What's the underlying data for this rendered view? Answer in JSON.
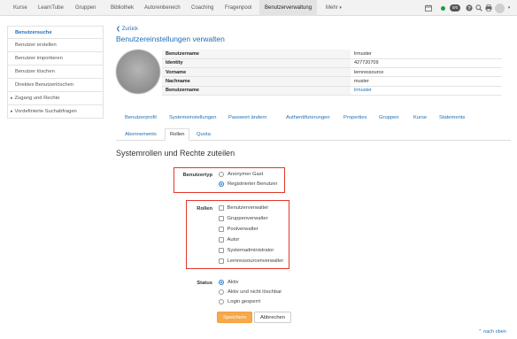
{
  "nav": {
    "items": [
      "Kurse",
      "LearnTube",
      "Gruppen",
      "Bibliothek",
      "Autorenbereich",
      "Coaching",
      "Fragenpool",
      "Benutzerverwaltung",
      "Mehr"
    ],
    "badge": "0/0"
  },
  "sidebar": {
    "items": [
      {
        "label": "Benutzersuche"
      },
      {
        "label": "Benutzer erstellen"
      },
      {
        "label": "Benutzer importieren"
      },
      {
        "label": "Benutzer löschen"
      },
      {
        "label": "Direktes Benutzerlöschen"
      },
      {
        "label": "Zugang und Rechte"
      },
      {
        "label": "Vordefinierte Suchabfragen"
      }
    ]
  },
  "main": {
    "back": "Zurück",
    "title": "Benutzereinstellungen verwalten",
    "info": [
      {
        "key": "Benutzername",
        "value": "lrmuster"
      },
      {
        "key": "Identity",
        "value": "427720709"
      },
      {
        "key": "Vorname",
        "value": "lernressource"
      },
      {
        "key": "Nachname",
        "value": "muster"
      },
      {
        "key": "Benutzername",
        "value": "lrmuster"
      }
    ],
    "tabs_row1": [
      "Benutzerprofil",
      "Systemeinstellungen",
      "Passwort ändern",
      "Authentifizierungen",
      "Properties",
      "Gruppen",
      "Kurse",
      "Statements"
    ],
    "tabs_row2": [
      "Abonnements",
      "Rollen",
      "Quota"
    ],
    "section_title": "Systemrollen und Rechte zuteilen",
    "benutzertyp": {
      "label": "Benutzertyp",
      "options": [
        "Anonymer Gast",
        "Registrierter Benutzer"
      ]
    },
    "rollen": {
      "label": "Rollen",
      "options": [
        "Benutzerverwalter",
        "Gruppenverwalter",
        "Poolverwalter",
        "Autor",
        "Systemadministrator",
        "Lernressourcenverwalter"
      ]
    },
    "status": {
      "label": "Status",
      "options": [
        "Aktiv",
        "Aktiv und nicht löschbar",
        "Login gesperrt"
      ]
    },
    "save": "Speichern",
    "cancel": "Abbrechen",
    "to_top": "nach oben"
  },
  "colors": {
    "link": "#1d6fb8",
    "primary_button": "#f6a84b",
    "highlight_box": "#e2382a",
    "online": "#1f9a3b"
  },
  "icons": [
    "calendar-icon",
    "online-status-icon",
    "help-icon",
    "search-icon",
    "print-icon",
    "user-avatar-icon",
    "chevron-up-icon"
  ]
}
